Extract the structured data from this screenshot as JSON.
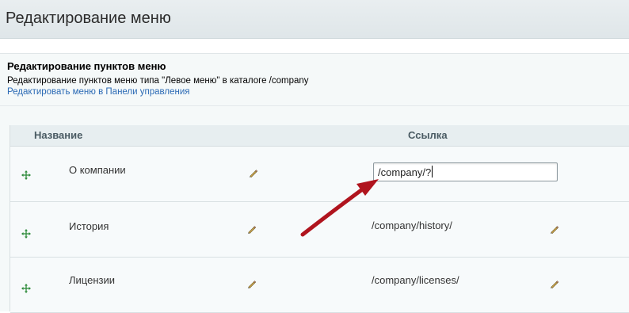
{
  "header": {
    "title": "Редактирование меню"
  },
  "section": {
    "title": "Редактирование пунктов меню",
    "description": "Редактирование пунктов меню типа \"Левое меню\" в каталоге /company",
    "link": "Редактировать меню в Панели управления"
  },
  "table": {
    "columns": {
      "name": "Название",
      "link": "Ссылка"
    },
    "rows": [
      {
        "name": "О компании",
        "link": "/company/?",
        "editing": true
      },
      {
        "name": "История",
        "link": "/company/history/",
        "editing": false
      },
      {
        "name": "Лицензии",
        "link": "/company/licenses/",
        "editing": false
      }
    ]
  },
  "icons": {
    "drag": "move-arrows-icon",
    "edit": "pencil-icon"
  },
  "colors": {
    "link": "#2c6bb5",
    "drag_icon": "#2e8b3a",
    "annotation_arrow": "#b0141e"
  }
}
